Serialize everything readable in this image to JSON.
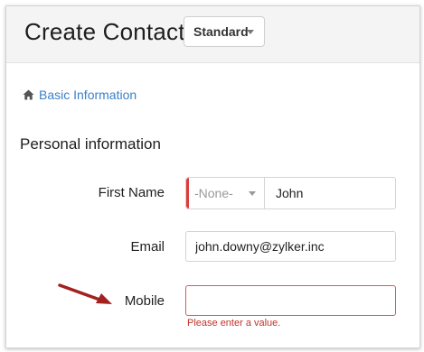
{
  "header": {
    "title": "Create Contact",
    "layout_select": "Standard"
  },
  "section": {
    "link_label": "Basic Information",
    "icon": "home-icon"
  },
  "subheading": "Personal information",
  "fields": {
    "first_name": {
      "label": "First Name",
      "salutation": "-None-",
      "value": "John"
    },
    "email": {
      "label": "Email",
      "value": "john.downy@zylker.inc"
    },
    "mobile": {
      "label": "Mobile",
      "value": "",
      "error": "Please enter a value."
    }
  },
  "colors": {
    "link": "#3b80c7",
    "error": "#c0342b",
    "mandatory": "#de3c3c",
    "arrow": "#a3211f"
  }
}
